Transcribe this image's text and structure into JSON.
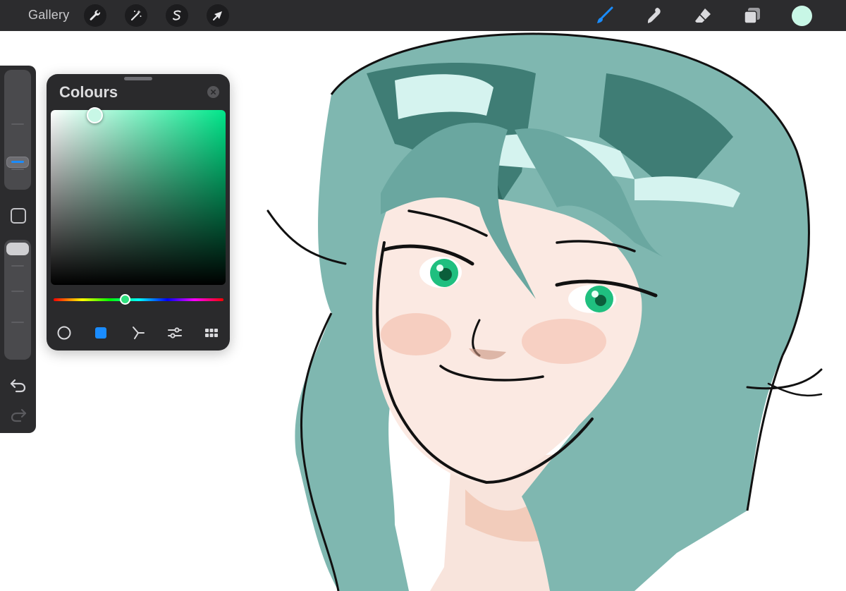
{
  "topbar": {
    "gallery_label": "Gallery",
    "left_tools": [
      "wrench-icon",
      "magic-wand-icon",
      "selection-s-icon",
      "transform-arrow-icon"
    ],
    "right_tools": [
      "brush-icon",
      "smudge-icon",
      "eraser-icon",
      "layers-icon"
    ],
    "active_tool": "brush-icon",
    "accent_color": "#1a8cff",
    "current_color": "#c8f7e6"
  },
  "sidebar": {
    "brush_size_level": 0.31,
    "brush_opacity_level": 0.05,
    "controls": [
      "size-slider",
      "modify-button",
      "opacity-slider",
      "undo-icon",
      "redo-icon"
    ]
  },
  "colours_panel": {
    "title": "Colours",
    "selected_color": "#c8f7e6",
    "hue_color": "#00e68a",
    "hue_position": 0.42,
    "saturation": 0.25,
    "brightness": 0.97,
    "modes": [
      "disc-icon",
      "classic-icon",
      "harmony-icon",
      "value-sliders-icon",
      "palettes-icon"
    ],
    "active_mode": "classic-icon"
  },
  "canvas": {
    "artwork": "anime-portrait"
  }
}
